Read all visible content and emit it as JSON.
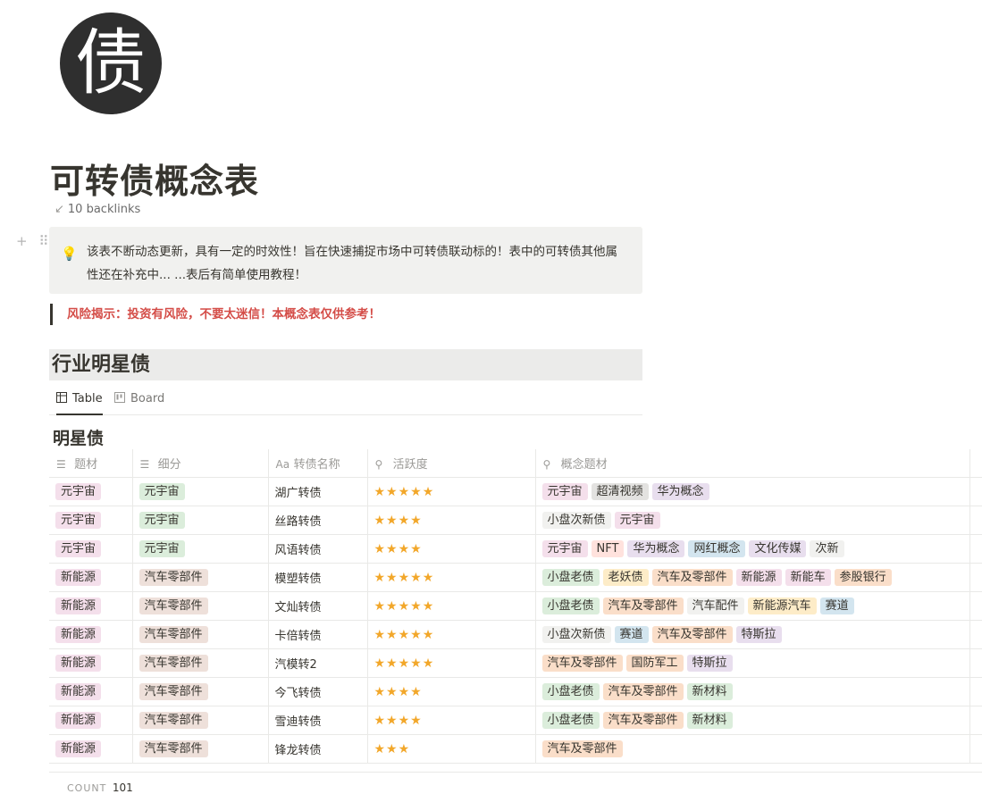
{
  "page": {
    "icon_char": "债",
    "title": "可转债概念表",
    "backlinks": "10 backlinks",
    "handle": "+ ⠿"
  },
  "callout": {
    "icon": "lightbulb-icon",
    "text": "该表不断动态更新，具有一定的时效性！旨在快速捕捉市场中可转债联动标的！表中的可转债其他属性还在补充中... ...表后有简单使用教程！"
  },
  "quote": "风险揭示：投资有风险，不要太迷信！本概念表仅供参考！",
  "section_heading": "行业明星债",
  "views": [
    {
      "label": "Table",
      "icon": "table-icon",
      "active": true
    },
    {
      "label": "Board",
      "icon": "board-icon",
      "active": false
    }
  ],
  "database": {
    "title": "明星债",
    "columns": [
      "题材",
      "细分",
      "转债名称",
      "活跃度",
      "概念题材"
    ],
    "column_icons": [
      "list-icon",
      "list-icon",
      "text-icon",
      "search-icon",
      "search-icon"
    ],
    "rows": [
      {
        "theme": {
          "text": "元宇宙",
          "color": "#f4dfeb"
        },
        "sub": {
          "text": "元宇宙",
          "color": "#dbeddb"
        },
        "name": "湖广转债",
        "stars": "★★★★★",
        "concepts": [
          {
            "text": "元宇宙",
            "color": "#f4dfeb"
          },
          {
            "text": "超清视频",
            "color": "#e3e2e0"
          },
          {
            "text": "华为概念",
            "color": "#e8deee"
          }
        ]
      },
      {
        "theme": {
          "text": "元宇宙",
          "color": "#f4dfeb"
        },
        "sub": {
          "text": "元宇宙",
          "color": "#dbeddb"
        },
        "name": "丝路转债",
        "stars": "★★★★",
        "concepts": [
          {
            "text": "小盘次新债",
            "color": "#f1f1ef"
          },
          {
            "text": "元宇宙",
            "color": "#f4dfeb"
          }
        ]
      },
      {
        "theme": {
          "text": "元宇宙",
          "color": "#f4dfeb"
        },
        "sub": {
          "text": "元宇宙",
          "color": "#dbeddb"
        },
        "name": "风语转债",
        "stars": "★★★★",
        "concepts": [
          {
            "text": "元宇宙",
            "color": "#f4dfeb"
          },
          {
            "text": "NFT",
            "color": "#ffe2dd"
          },
          {
            "text": "华为概念",
            "color": "#e8deee"
          },
          {
            "text": "网红概念",
            "color": "#d3e5ef"
          },
          {
            "text": "文化传媒",
            "color": "#e8deee"
          },
          {
            "text": "次新",
            "color": "#f1f1ef"
          }
        ]
      },
      {
        "theme": {
          "text": "新能源",
          "color": "#f4dfeb"
        },
        "sub": {
          "text": "汽车零部件",
          "color": "#eee0da"
        },
        "name": "模塑转债",
        "stars": "★★★★★",
        "concepts": [
          {
            "text": "小盘老债",
            "color": "#dbeddb"
          },
          {
            "text": "老妖债",
            "color": "#fdecc8"
          },
          {
            "text": "汽车及零部件",
            "color": "#fadec9"
          },
          {
            "text": "新能源",
            "color": "#f4dfeb"
          },
          {
            "text": "新能车",
            "color": "#f4dfeb"
          },
          {
            "text": "参股银行",
            "color": "#fadec9"
          }
        ]
      },
      {
        "theme": {
          "text": "新能源",
          "color": "#f4dfeb"
        },
        "sub": {
          "text": "汽车零部件",
          "color": "#eee0da"
        },
        "name": "文灿转债",
        "stars": "★★★★★",
        "concepts": [
          {
            "text": "小盘老债",
            "color": "#dbeddb"
          },
          {
            "text": "汽车及零部件",
            "color": "#fadec9"
          },
          {
            "text": "汽车配件",
            "color": "#f1f1ef"
          },
          {
            "text": "新能源汽车",
            "color": "#fdecc8"
          },
          {
            "text": "赛道",
            "color": "#d3e5ef"
          }
        ]
      },
      {
        "theme": {
          "text": "新能源",
          "color": "#f4dfeb"
        },
        "sub": {
          "text": "汽车零部件",
          "color": "#eee0da"
        },
        "name": "卡倍转债",
        "stars": "★★★★★",
        "concepts": [
          {
            "text": "小盘次新债",
            "color": "#f1f1ef"
          },
          {
            "text": "赛道",
            "color": "#d3e5ef"
          },
          {
            "text": "汽车及零部件",
            "color": "#fadec9"
          },
          {
            "text": "特斯拉",
            "color": "#e8deee"
          }
        ]
      },
      {
        "theme": {
          "text": "新能源",
          "color": "#f4dfeb"
        },
        "sub": {
          "text": "汽车零部件",
          "color": "#eee0da"
        },
        "name": "汽模转2",
        "stars": "★★★★★",
        "concepts": [
          {
            "text": "汽车及零部件",
            "color": "#fadec9"
          },
          {
            "text": "国防军工",
            "color": "#fadec9"
          },
          {
            "text": "特斯拉",
            "color": "#e8deee"
          }
        ]
      },
      {
        "theme": {
          "text": "新能源",
          "color": "#f4dfeb"
        },
        "sub": {
          "text": "汽车零部件",
          "color": "#eee0da"
        },
        "name": "今飞转债",
        "stars": "★★★★",
        "concepts": [
          {
            "text": "小盘老债",
            "color": "#dbeddb"
          },
          {
            "text": "汽车及零部件",
            "color": "#fadec9"
          },
          {
            "text": "新材料",
            "color": "#dbeddb"
          }
        ]
      },
      {
        "theme": {
          "text": "新能源",
          "color": "#f4dfeb"
        },
        "sub": {
          "text": "汽车零部件",
          "color": "#eee0da"
        },
        "name": "雪迪转债",
        "stars": "★★★★",
        "concepts": [
          {
            "text": "小盘老债",
            "color": "#dbeddb"
          },
          {
            "text": "汽车及零部件",
            "color": "#fadec9"
          },
          {
            "text": "新材料",
            "color": "#dbeddb"
          }
        ]
      },
      {
        "theme": {
          "text": "新能源",
          "color": "#f4dfeb"
        },
        "sub": {
          "text": "汽车零部件",
          "color": "#eee0da"
        },
        "name": "锋龙转债",
        "stars": "★★★",
        "concepts": [
          {
            "text": "汽车及零部件",
            "color": "#fadec9"
          }
        ]
      }
    ],
    "count_label": "COUNT",
    "count_value": "101"
  }
}
